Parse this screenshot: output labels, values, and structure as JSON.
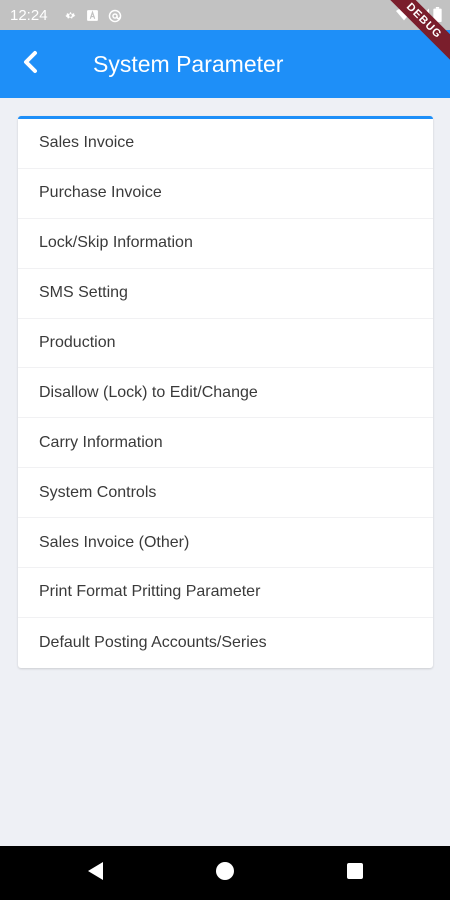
{
  "status_bar": {
    "time": "12:24",
    "left_icons": [
      "gear-icon",
      "a-box-icon",
      "at-sign-icon"
    ],
    "right_icons": [
      "wifi-icon",
      "signal-icon",
      "battery-icon"
    ]
  },
  "debug_banner": "DEBUG",
  "app_bar": {
    "title": "System Parameter",
    "back_icon": "chevron-left-icon"
  },
  "menu": {
    "items": [
      {
        "label": "Sales Invoice"
      },
      {
        "label": "Purchase Invoice"
      },
      {
        "label": "Lock/Skip Information"
      },
      {
        "label": "SMS Setting"
      },
      {
        "label": "Production"
      },
      {
        "label": "Disallow (Lock) to Edit/Change"
      },
      {
        "label": "Carry Information"
      },
      {
        "label": "System Controls"
      },
      {
        "label": "Sales Invoice (Other)"
      },
      {
        "label": "Print Format Pritting Parameter"
      },
      {
        "label": "Default Posting Accounts/Series"
      }
    ]
  },
  "nav_bar": {
    "buttons": [
      "back-triangle-icon",
      "home-circle-icon",
      "recents-square-icon"
    ]
  },
  "colors": {
    "primary": "#1e8ff8",
    "background": "#eef0f5",
    "status_bar": "#c2c2c2",
    "debug_ribbon": "#7a1e2c"
  }
}
